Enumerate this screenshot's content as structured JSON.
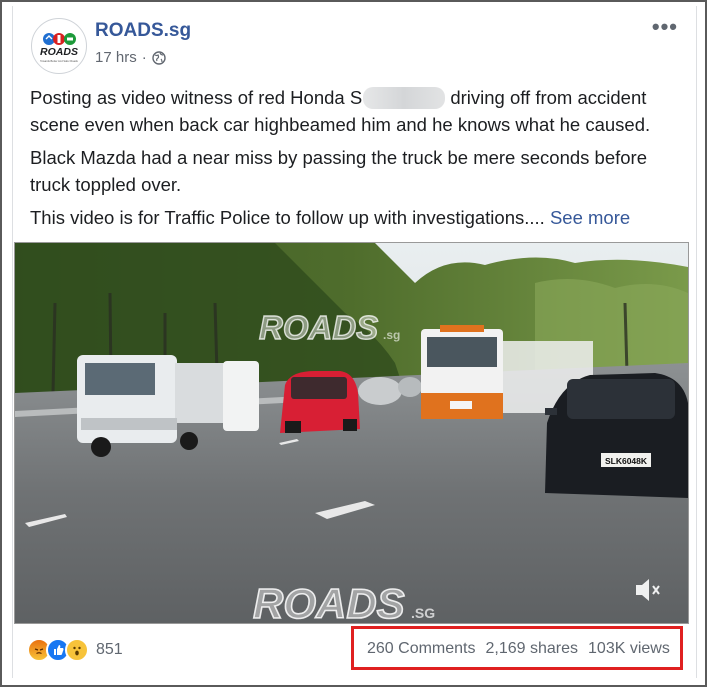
{
  "post": {
    "page_name": "ROADS.sg",
    "avatar_logo_text": "ROADS",
    "avatar_tagline": "Towards Better And Safer Roads",
    "time": "17 hrs",
    "separator": "·",
    "paragraph1_before": "Posting as video witness of red Honda S",
    "paragraph1_after": "driving off from accident scene even when back car highbeamed him and he knows what he caused.",
    "paragraph2": "Black Mazda had a near miss by passing the truck be mere seconds before truck toppled over.",
    "paragraph3": "This video is for Traffic Police to follow up with investigations....",
    "see_more": "See more"
  },
  "video": {
    "watermark_top": "ROADS",
    "watermark_top_suffix": ".sg",
    "watermark_bottom": "ROADS",
    "watermark_bottom_suffix": ".SG",
    "plate": "SLK6048K"
  },
  "footer": {
    "reaction_icons": [
      "angry-icon",
      "like-icon",
      "wow-icon"
    ],
    "reaction_count": "851",
    "comments": "260 Comments",
    "shares": "2,169 shares",
    "views": "103K views"
  },
  "colors": {
    "link": "#365899",
    "highlight": "#e02020",
    "like": "#1877f2",
    "reaction_yellow": "#f7c33a",
    "angry_top": "#e9710f"
  }
}
